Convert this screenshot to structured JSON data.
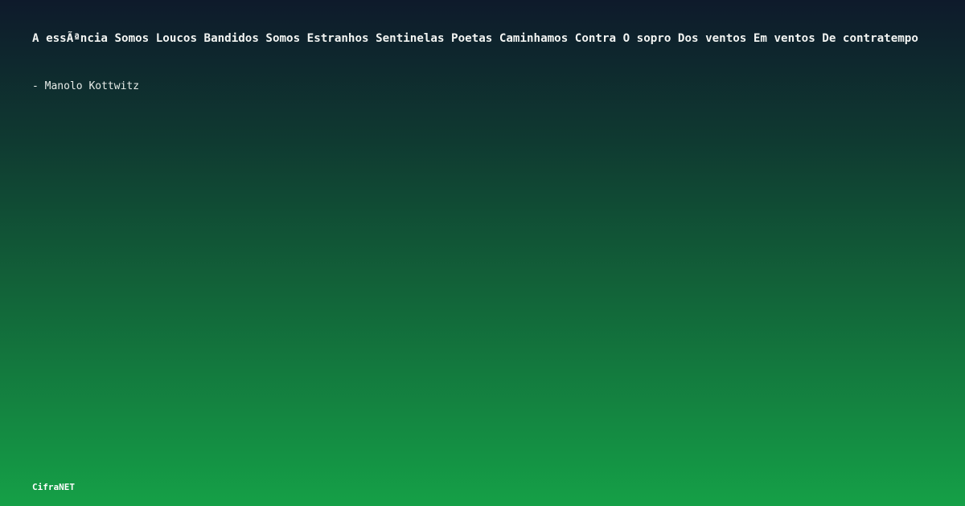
{
  "quote": {
    "text": "A essÃªncia Somos Loucos Bandidos Somos Estranhos Sentinelas Poetas Caminhamos Contra O sopro Dos ventos Em ventos De contratempo"
  },
  "author": {
    "text": "- Manolo Kottwitz"
  },
  "brand": {
    "name": "CifraNET"
  },
  "colors": {
    "gradient_top": "#0e1a2b",
    "gradient_bottom": "#15a047",
    "text": "#f2f4f2"
  }
}
